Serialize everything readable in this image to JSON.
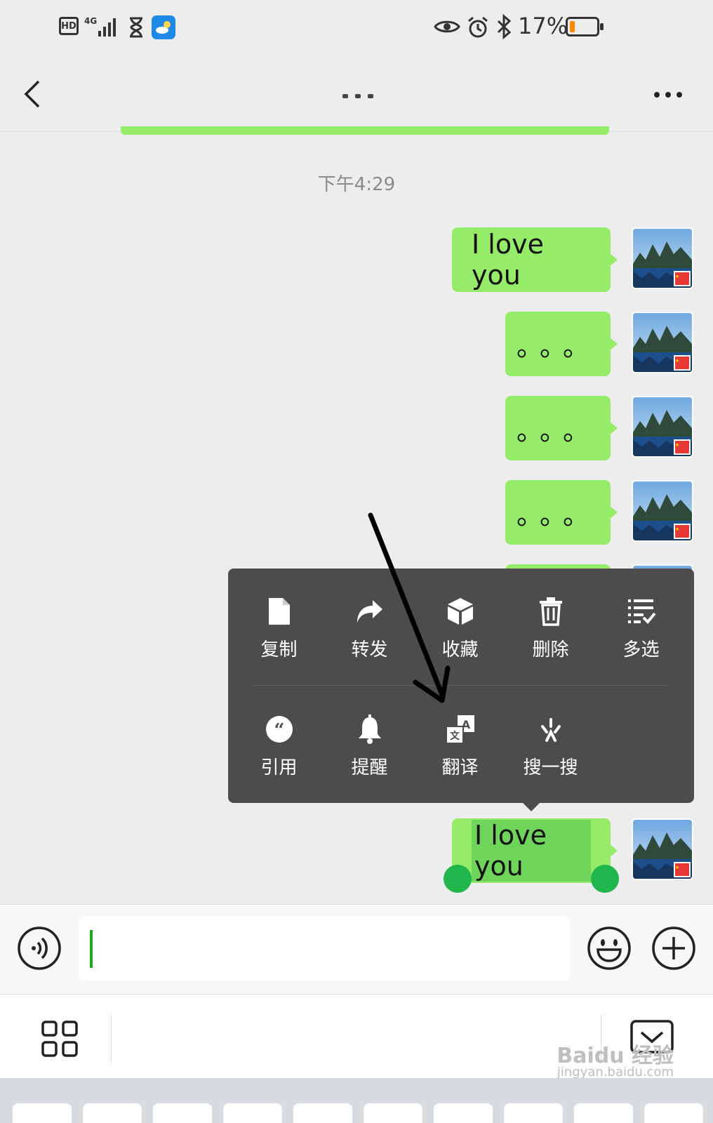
{
  "status_bar": {
    "hd": "HD",
    "network": "4G",
    "battery_percent": "17%",
    "battery_level": 0.17
  },
  "nav": {
    "back": "back",
    "more": "more"
  },
  "chat": {
    "timestamp": "下午4:29",
    "messages": [
      {
        "text": "I love you"
      },
      {
        "text": "。。。"
      },
      {
        "text": "。。。"
      },
      {
        "text": "。。。"
      },
      {
        "text": "I love you",
        "selected": true
      }
    ]
  },
  "menu": {
    "row1": [
      {
        "label": "复制",
        "icon": "copy-icon"
      },
      {
        "label": "转发",
        "icon": "forward-icon"
      },
      {
        "label": "收藏",
        "icon": "favorite-icon"
      },
      {
        "label": "删除",
        "icon": "delete-icon"
      },
      {
        "label": "多选",
        "icon": "multiselect-icon"
      }
    ],
    "row2": [
      {
        "label": "引用",
        "icon": "quote-icon"
      },
      {
        "label": "提醒",
        "icon": "remind-icon"
      },
      {
        "label": "翻译",
        "icon": "translate-icon"
      },
      {
        "label": "搜一搜",
        "icon": "search-icon"
      }
    ]
  },
  "input": {
    "value": ""
  },
  "watermark": {
    "brand": "Baidu 经验",
    "url": "jingyan.baidu.com"
  },
  "colors": {
    "bubble": "#95ec69",
    "menu_bg": "#4c4c4c",
    "handle": "#1fb64b",
    "battery_low": "#ff8a00"
  }
}
